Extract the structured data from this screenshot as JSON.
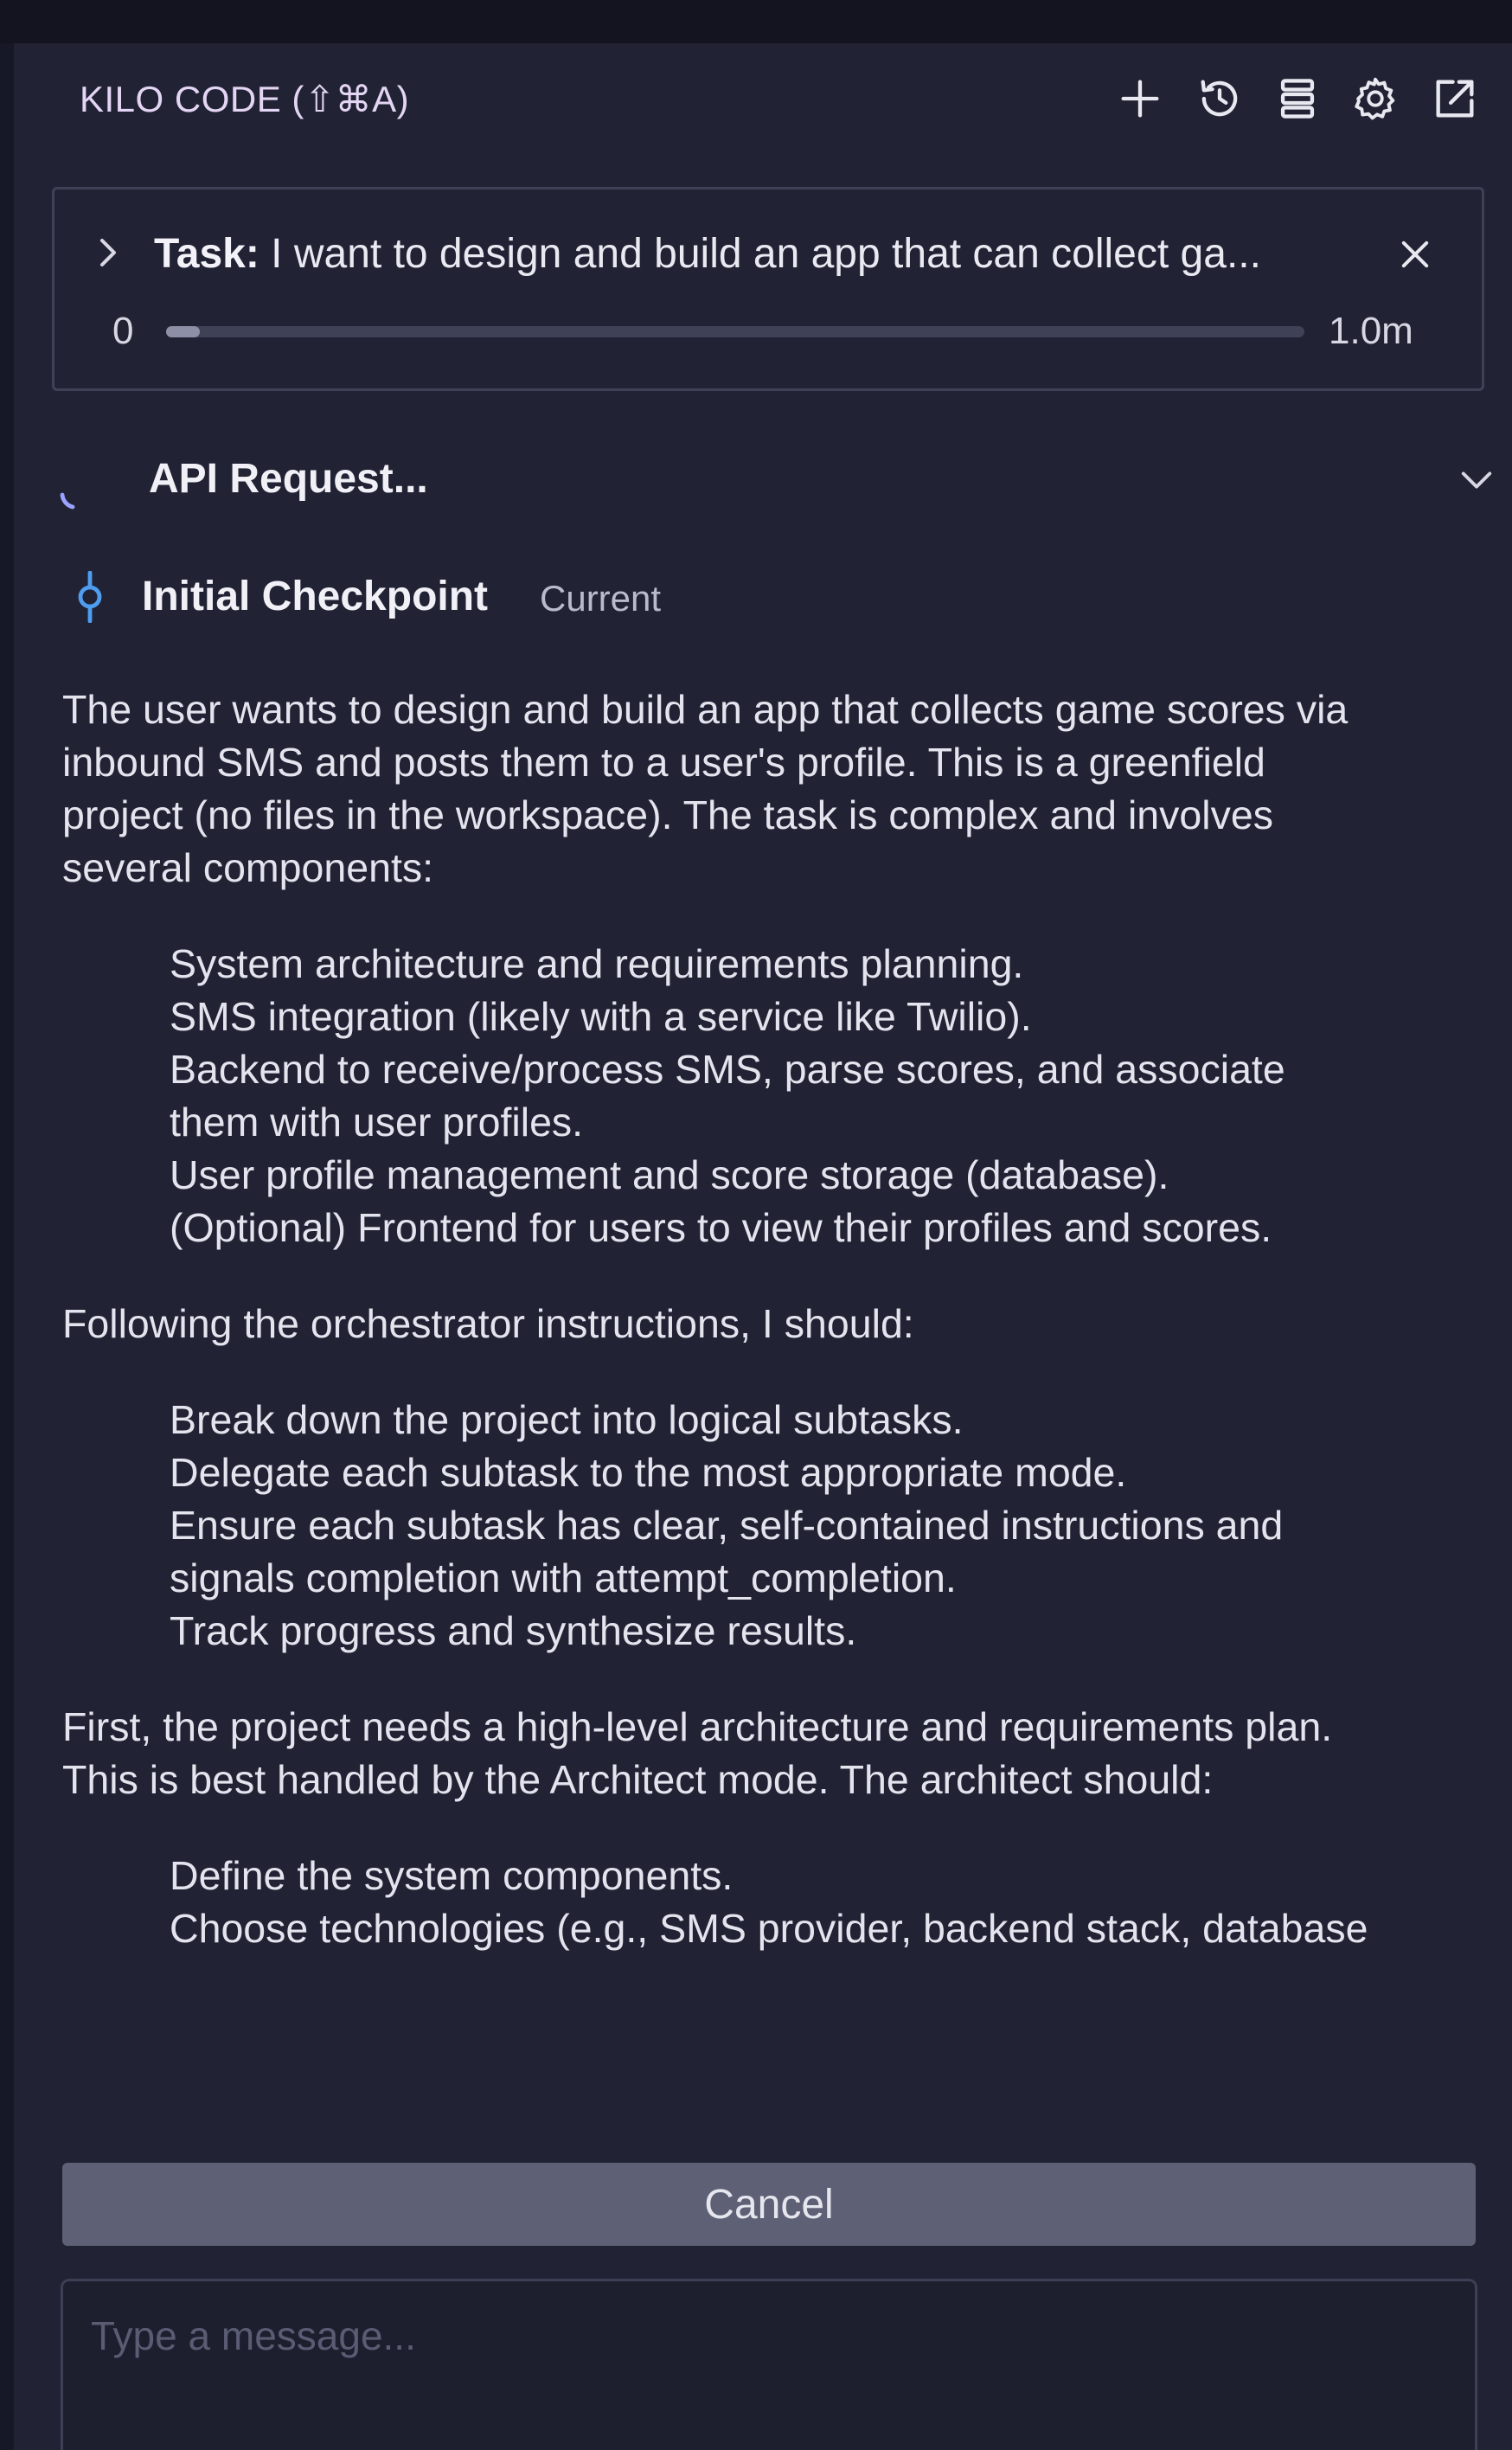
{
  "header": {
    "title": "KILO CODE (⇧⌘A)",
    "actions": [
      {
        "name": "new-task",
        "icon": "plus-icon"
      },
      {
        "name": "history",
        "icon": "history-icon"
      },
      {
        "name": "mcp-servers",
        "icon": "server-stack-icon"
      },
      {
        "name": "settings",
        "icon": "gear-icon"
      },
      {
        "name": "open-in-editor",
        "icon": "external-link-icon"
      }
    ]
  },
  "task": {
    "label": "Task:",
    "text": " I want to design and build an app that can collect ga...",
    "progress_start": "0",
    "progress_end": "1.0m",
    "progress_fraction": 0.03
  },
  "api_request": {
    "label": "API Request..."
  },
  "checkpoint": {
    "label": "Initial Checkpoint",
    "status": "Current"
  },
  "message": {
    "intro_lines": [
      "The user wants to design and build an app that collects game scores via",
      "inbound SMS and posts them to a user's profile. This is a greenfield",
      "project (no files in the workspace). The task is complex and involves",
      "several components:"
    ],
    "components": [
      "System architecture and requirements planning.",
      "SMS integration (likely with a service like Twilio).",
      "Backend to receive/process SMS, parse scores, and associate",
      "them with user profiles.",
      "User profile management and score storage (database).",
      "(Optional) Frontend for users to view their profiles and scores."
    ],
    "following": "Following the orchestrator instructions, I should:",
    "steps": [
      "Break down the project into logical subtasks.",
      "Delegate each subtask to the most appropriate mode.",
      "Ensure each subtask has clear, self-contained instructions and",
      "signals completion with attempt_completion.",
      "Track progress and synthesize results."
    ],
    "first_lines": [
      "First, the project needs a high-level architecture and requirements plan.",
      "This is best handled by the Architect mode. The architect should:"
    ],
    "architect_items": [
      "Define the system components.",
      "Choose technologies (e.g., SMS provider, backend stack, database"
    ]
  },
  "cancel_label": "Cancel",
  "input": {
    "placeholder": "Type a message..."
  },
  "colors": {
    "background": "#161826",
    "panel": "#212334",
    "title": "#e4d5f5",
    "checkpoint_icon": "#4f9df0",
    "cancel_button": "#5e6075"
  }
}
